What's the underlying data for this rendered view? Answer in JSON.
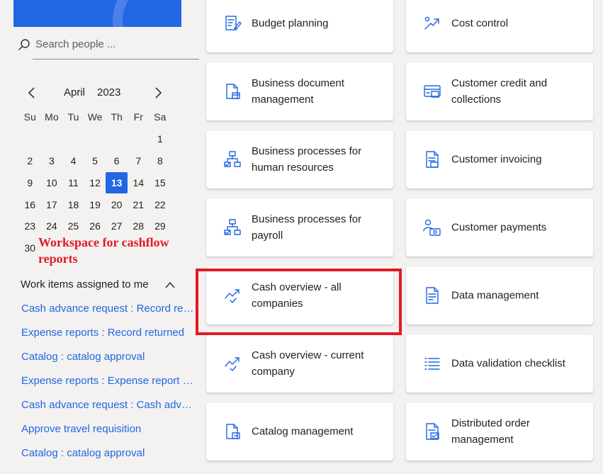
{
  "search": {
    "placeholder": "Search people ..."
  },
  "calendar": {
    "month": "April",
    "year": "2023",
    "weekdays": [
      "Su",
      "Mo",
      "Tu",
      "We",
      "Th",
      "Fr",
      "Sa"
    ],
    "days": [
      "",
      "",
      "",
      "",
      "",
      "",
      "1",
      "2",
      "3",
      "4",
      "5",
      "6",
      "7",
      "8",
      "9",
      "10",
      "11",
      "12",
      "13",
      "14",
      "15",
      "16",
      "17",
      "18",
      "19",
      "20",
      "21",
      "22",
      "23",
      "24",
      "25",
      "26",
      "27",
      "28",
      "29",
      "30"
    ],
    "selected_day": "13"
  },
  "annotation": {
    "text": "Workspace for cashflow reports"
  },
  "work_items": {
    "header": "Work items assigned to me",
    "items": [
      "Cash advance request : Record ret...",
      "Expense reports : Record returned",
      "Catalog : catalog approval",
      "Expense reports : Expense report a...",
      "Cash advance request : Cash advan...",
      "Approve travel requisition",
      "Catalog : catalog approval"
    ]
  },
  "tiles": [
    {
      "label": "Budget planning",
      "icon": "budget-planning-icon"
    },
    {
      "label": "Cost control",
      "icon": "cost-control-icon"
    },
    {
      "label": "Business document management",
      "icon": "business-document-icon"
    },
    {
      "label": "Customer credit and collections",
      "icon": "customer-credit-icon"
    },
    {
      "label": "Business processes for human resources",
      "icon": "process-hierarchy-icon"
    },
    {
      "label": "Customer invoicing",
      "icon": "invoice-icon"
    },
    {
      "label": "Business processes for payroll",
      "icon": "process-hierarchy-icon"
    },
    {
      "label": "Customer payments",
      "icon": "customer-payments-icon"
    },
    {
      "label": "Cash overview - all companies",
      "icon": "trend-check-icon"
    },
    {
      "label": "Data management",
      "icon": "data-management-icon"
    },
    {
      "label": "Cash overview - current company",
      "icon": "trend-check-icon"
    },
    {
      "label": "Data validation checklist",
      "icon": "checklist-icon"
    },
    {
      "label": "Catalog management",
      "icon": "catalog-icon"
    },
    {
      "label": "Distributed order management",
      "icon": "order-management-icon"
    }
  ],
  "colors": {
    "accent": "#2266e3",
    "annotation": "#e01b24",
    "link": "#2266e3"
  }
}
